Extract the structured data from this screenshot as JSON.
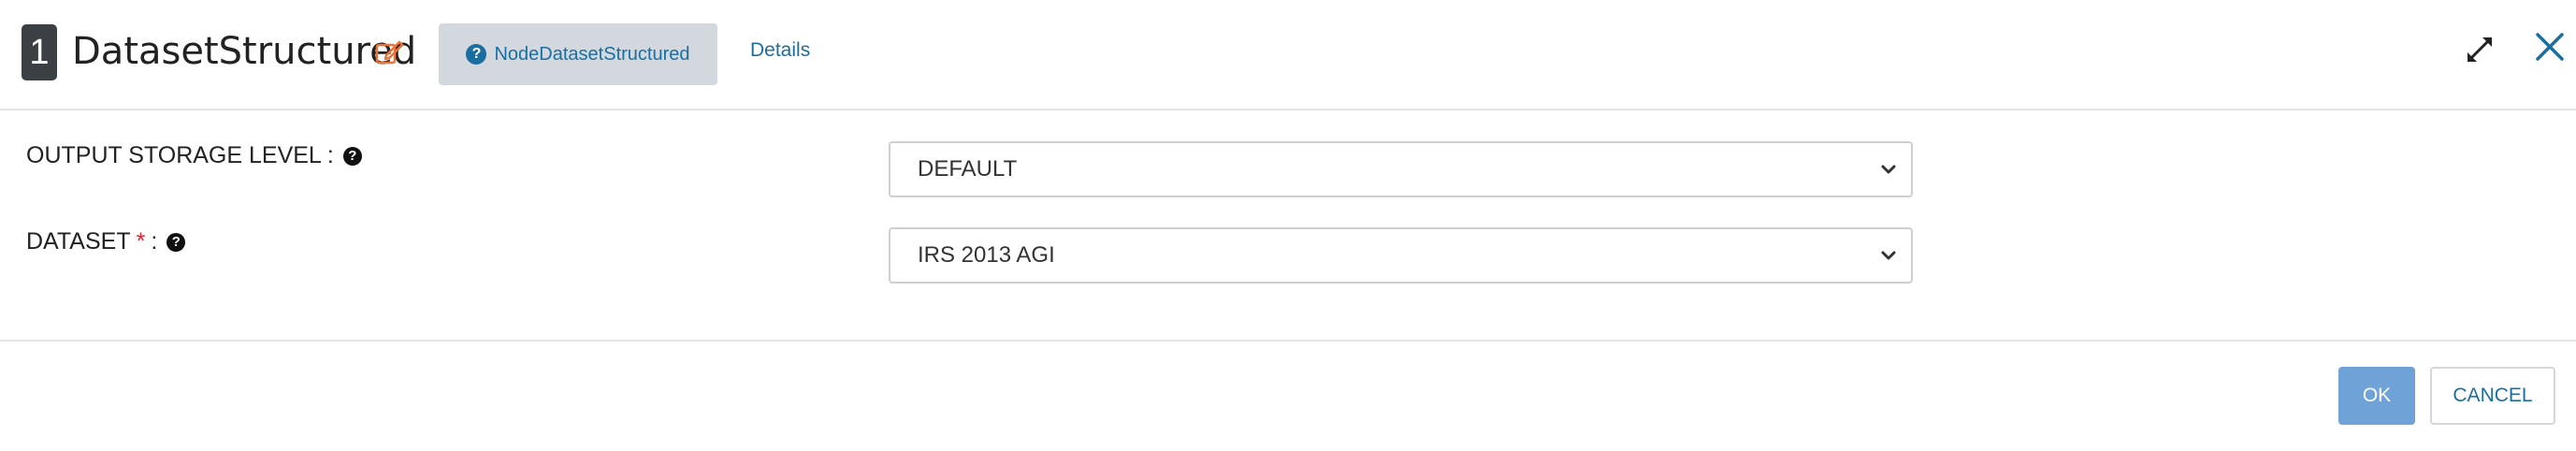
{
  "header": {
    "node_number": "1",
    "title": "DatasetStructured",
    "help_button_label": "NodeDatasetStructured",
    "details_link": "Details"
  },
  "icons": {
    "edit": "edit-icon",
    "help": "question-circle-icon",
    "expand": "expand-icon",
    "close": "close-icon",
    "chevron": "chevron-down-icon"
  },
  "form": {
    "output_storage_level": {
      "label": "OUTPUT STORAGE LEVEL",
      "separator": ":",
      "value": "DEFAULT"
    },
    "dataset": {
      "label": "DATASET",
      "required_marker": "*",
      "separator": ":",
      "value": "IRS 2013 AGI"
    }
  },
  "footer": {
    "ok_label": "OK",
    "cancel_label": "CANCEL"
  },
  "colors": {
    "accent": "#1a6fa0",
    "ok_button": "#6fa3d8",
    "edit_icon": "#e8743b",
    "required": "#e0252e"
  }
}
